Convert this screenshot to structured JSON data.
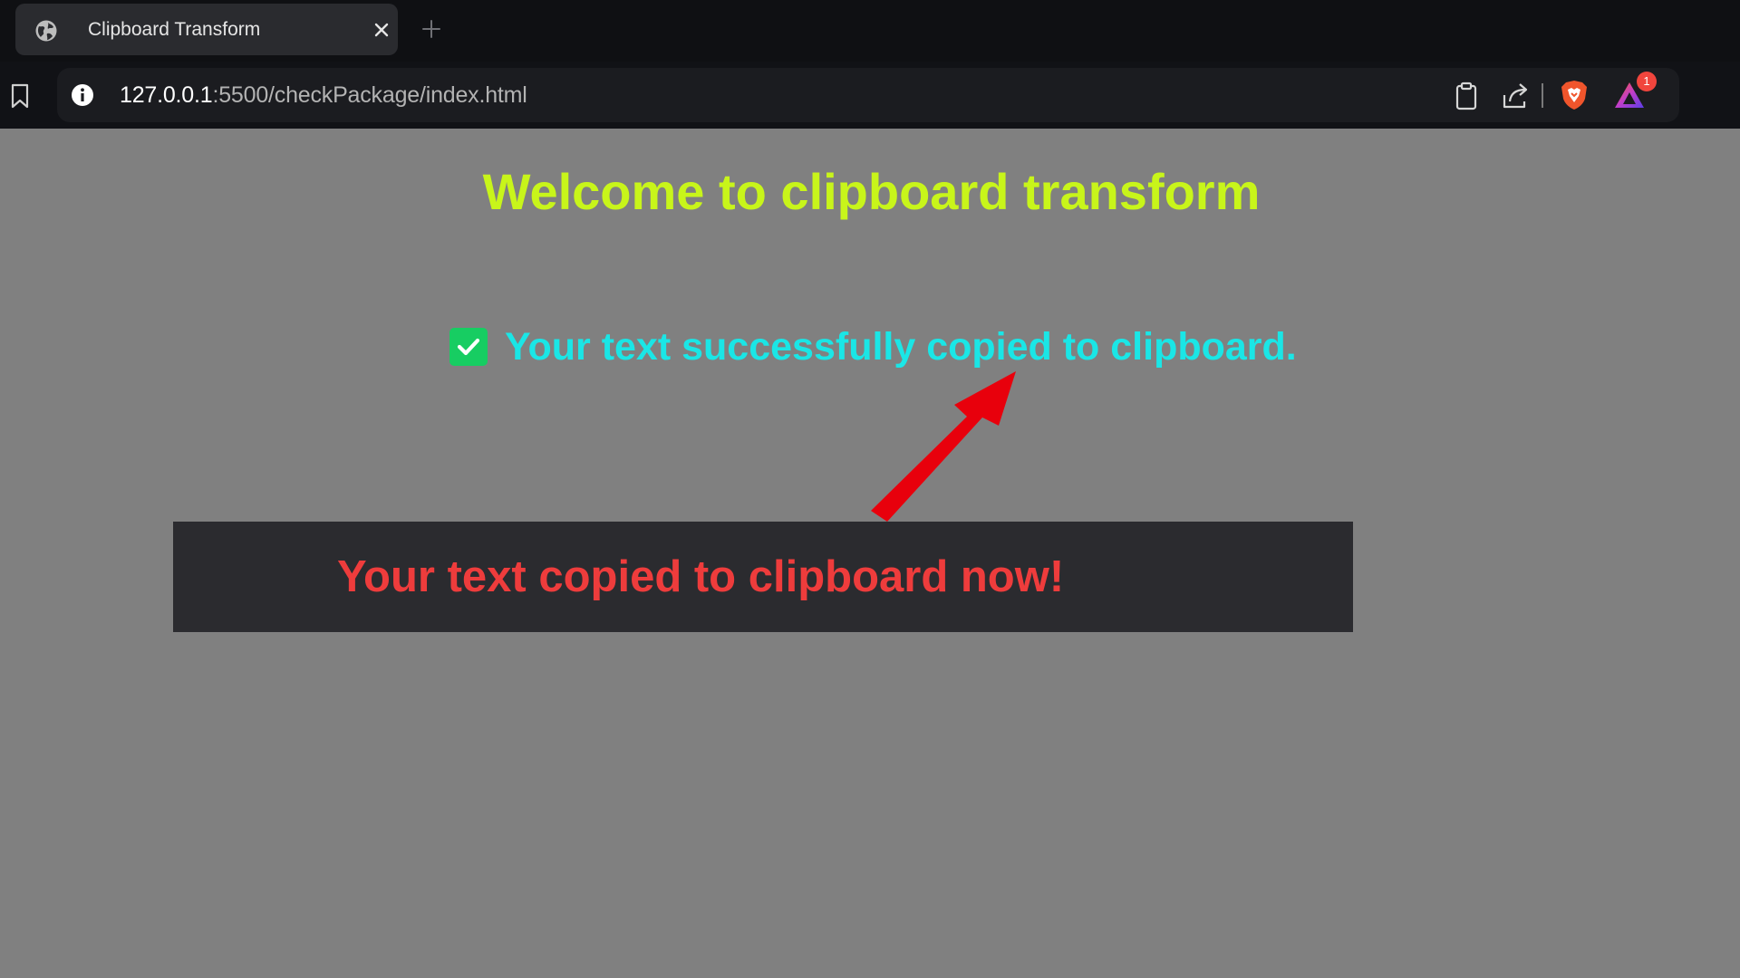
{
  "browser": {
    "tab": {
      "title": "Clipboard Transform",
      "favicon_icon": "globe-icon",
      "close_icon": "close-icon"
    },
    "new_tab_icon": "plus-icon",
    "toolbar": {
      "bookmark_icon": "bookmark-icon",
      "site_info_icon": "info-icon",
      "url_host": "127.0.0.1",
      "url_path": ":5500/checkPackage/index.html",
      "actions": [
        "clipboard-icon",
        "share-icon",
        "brave-shield-icon",
        "brave-rewards-icon"
      ],
      "rewards_badge": "1"
    }
  },
  "page": {
    "heading": "Welcome to clipboard transform",
    "status": {
      "icon": "checkbox-checked-icon",
      "text": "Your text successfully copied to clipboard."
    },
    "toast": {
      "text": "Your text copied to clipboard now!"
    }
  },
  "colors": {
    "page_background": "#808080",
    "heading": "#c8f51a",
    "status_text": "#1ae6e6",
    "check_box": "#17cd62",
    "toast_background": "#2b2b2f",
    "toast_text": "#ee3c3c",
    "annotation_arrow": "#e8000c"
  }
}
